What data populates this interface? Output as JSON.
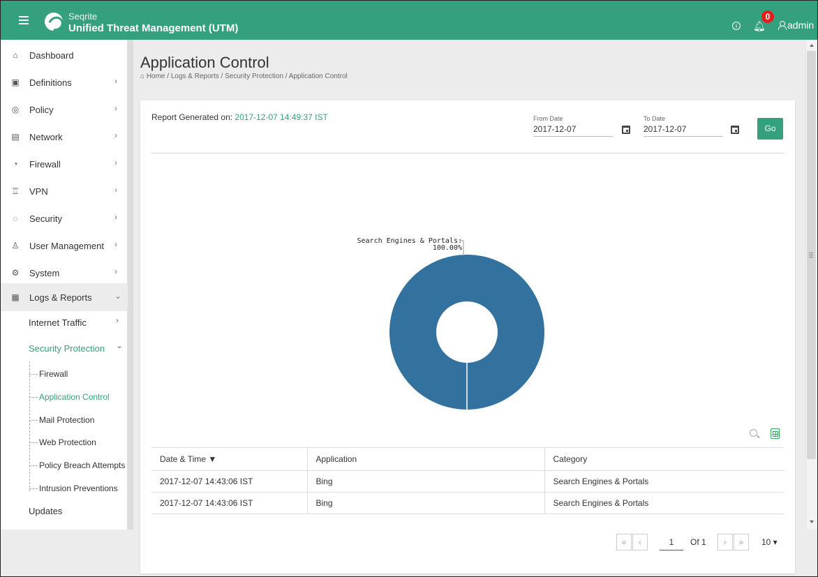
{
  "header": {
    "brand_small": "Seqrite",
    "brand_title": "Unified Threat Management (UTM)",
    "notification_count": "0",
    "user_name": "admin"
  },
  "sidebar": {
    "items": [
      {
        "label": "Dashboard",
        "icon": "home-icon"
      },
      {
        "label": "Definitions",
        "icon": "definitions-icon"
      },
      {
        "label": "Policy",
        "icon": "policy-icon"
      },
      {
        "label": "Network",
        "icon": "network-icon"
      },
      {
        "label": "Firewall",
        "icon": "firewall-icon"
      },
      {
        "label": "VPN",
        "icon": "vpn-icon"
      },
      {
        "label": "Security",
        "icon": "shield-icon"
      },
      {
        "label": "User Management",
        "icon": "user-add-icon"
      },
      {
        "label": "System",
        "icon": "gear-icon"
      },
      {
        "label": "Logs & Reports",
        "icon": "document-icon"
      }
    ],
    "sub": {
      "internet_traffic": "Internet Traffic",
      "security_protection": "Security Protection",
      "leaves": [
        "Firewall",
        "Application Control",
        "Mail Protection",
        "Web Protection",
        "Policy Breach Attempts",
        "Intrusion Preventions"
      ],
      "updates": "Updates"
    }
  },
  "page": {
    "title": "Application Control",
    "breadcrumb": "⌂ Home / Logs & Reports / Security Protection / Application Control"
  },
  "report": {
    "generated_label": "Report Generated on: ",
    "generated_value": "2017-12-07 14:49:37 IST",
    "from_label": "From Date",
    "from_value": "2017-12-07",
    "to_label": "To Date",
    "to_value": "2017-12-07",
    "go_label": "Go"
  },
  "chart_data": {
    "type": "pie",
    "style": "donut",
    "slices": [
      {
        "label": "Search Engines & Portals",
        "value": 100.0,
        "display": "100.00%",
        "color": "#33729f"
      }
    ]
  },
  "table": {
    "columns": [
      "Date & Time ▼",
      "Application",
      "Category"
    ],
    "rows": [
      [
        "2017-12-07 14:43:06 IST",
        "Bing",
        "Search Engines & Portals"
      ],
      [
        "2017-12-07 14:43:06 IST",
        "Bing",
        "Search Engines & Portals"
      ]
    ]
  },
  "pagination": {
    "page": "1",
    "of_label": "Of 1",
    "page_size": "10 ▾"
  },
  "colors": {
    "accent": "#34a07e",
    "chart": "#33729f",
    "badge": "#e2201c"
  }
}
